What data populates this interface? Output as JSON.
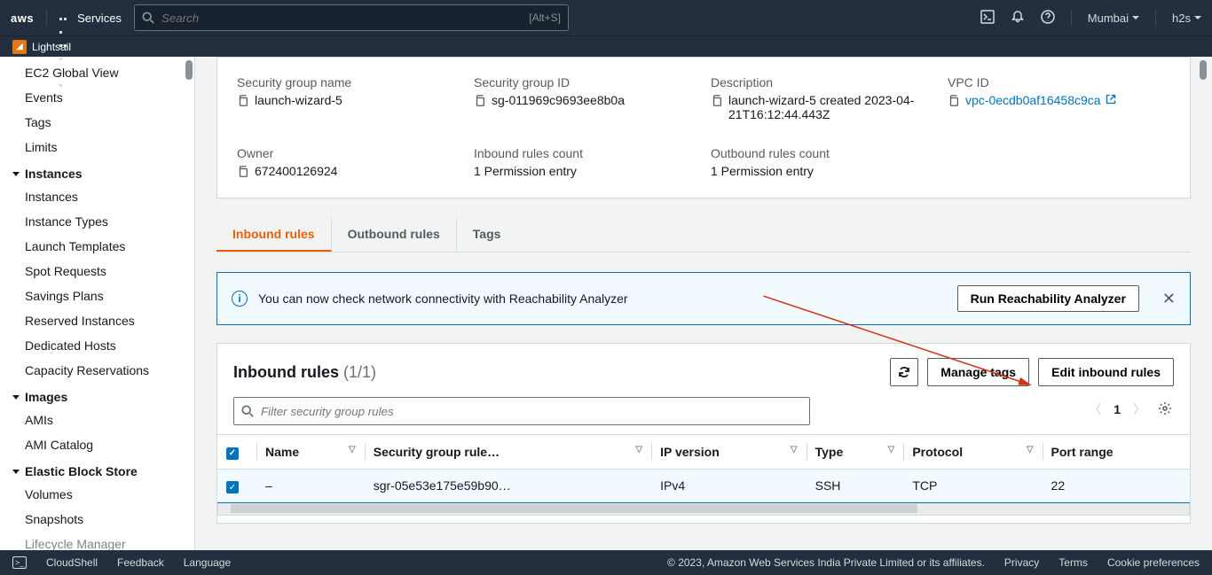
{
  "topnav": {
    "services_label": "Services",
    "search_placeholder": "Search",
    "search_shortcut": "[Alt+S]",
    "region": "Mumbai",
    "account": "h2s"
  },
  "subnav": {
    "lightsail": "Lightsail"
  },
  "sidebar": {
    "items_top": [
      "EC2 Global View",
      "Events",
      "Tags",
      "Limits"
    ],
    "group_instances": "Instances",
    "items_instances": [
      "Instances",
      "Instance Types",
      "Launch Templates",
      "Spot Requests",
      "Savings Plans",
      "Reserved Instances",
      "Dedicated Hosts",
      "Capacity Reservations"
    ],
    "group_images": "Images",
    "items_images": [
      "AMIs",
      "AMI Catalog"
    ],
    "group_ebs": "Elastic Block Store",
    "items_ebs": [
      "Volumes",
      "Snapshots",
      "Lifecycle Manager"
    ]
  },
  "details": {
    "sg_name_label": "Security group name",
    "sg_name": "launch-wizard-5",
    "sg_id_label": "Security group ID",
    "sg_id": "sg-011969c9693ee8b0a",
    "desc_label": "Description",
    "desc": "launch-wizard-5 created 2023-04-21T16:12:44.443Z",
    "vpc_label": "VPC ID",
    "vpc": "vpc-0ecdb0af16458c9ca",
    "owner_label": "Owner",
    "owner": "672400126924",
    "inbound_count_label": "Inbound rules count",
    "inbound_count": "1 Permission entry",
    "outbound_count_label": "Outbound rules count",
    "outbound_count": "1 Permission entry"
  },
  "tabs": {
    "inbound": "Inbound rules",
    "outbound": "Outbound rules",
    "tags": "Tags"
  },
  "banner": {
    "text": "You can now check network connectivity with Reachability Analyzer",
    "button": "Run Reachability Analyzer"
  },
  "rules": {
    "title": "Inbound rules",
    "count": "(1/1)",
    "manage_tags": "Manage tags",
    "edit": "Edit inbound rules",
    "search_placeholder": "Filter security group rules",
    "page": "1",
    "columns": [
      "Name",
      "Security group rule…",
      "IP version",
      "Type",
      "Protocol",
      "Port range"
    ],
    "rows": [
      {
        "name": "–",
        "sgr": "sgr-05e53e175e59b90…",
        "ipv": "IPv4",
        "type": "SSH",
        "proto": "TCP",
        "port": "22"
      }
    ]
  },
  "footer": {
    "cloudshell": "CloudShell",
    "feedback": "Feedback",
    "language": "Language",
    "copyright": "© 2023, Amazon Web Services India Private Limited or its affiliates.",
    "privacy": "Privacy",
    "terms": "Terms",
    "cookies": "Cookie preferences"
  }
}
